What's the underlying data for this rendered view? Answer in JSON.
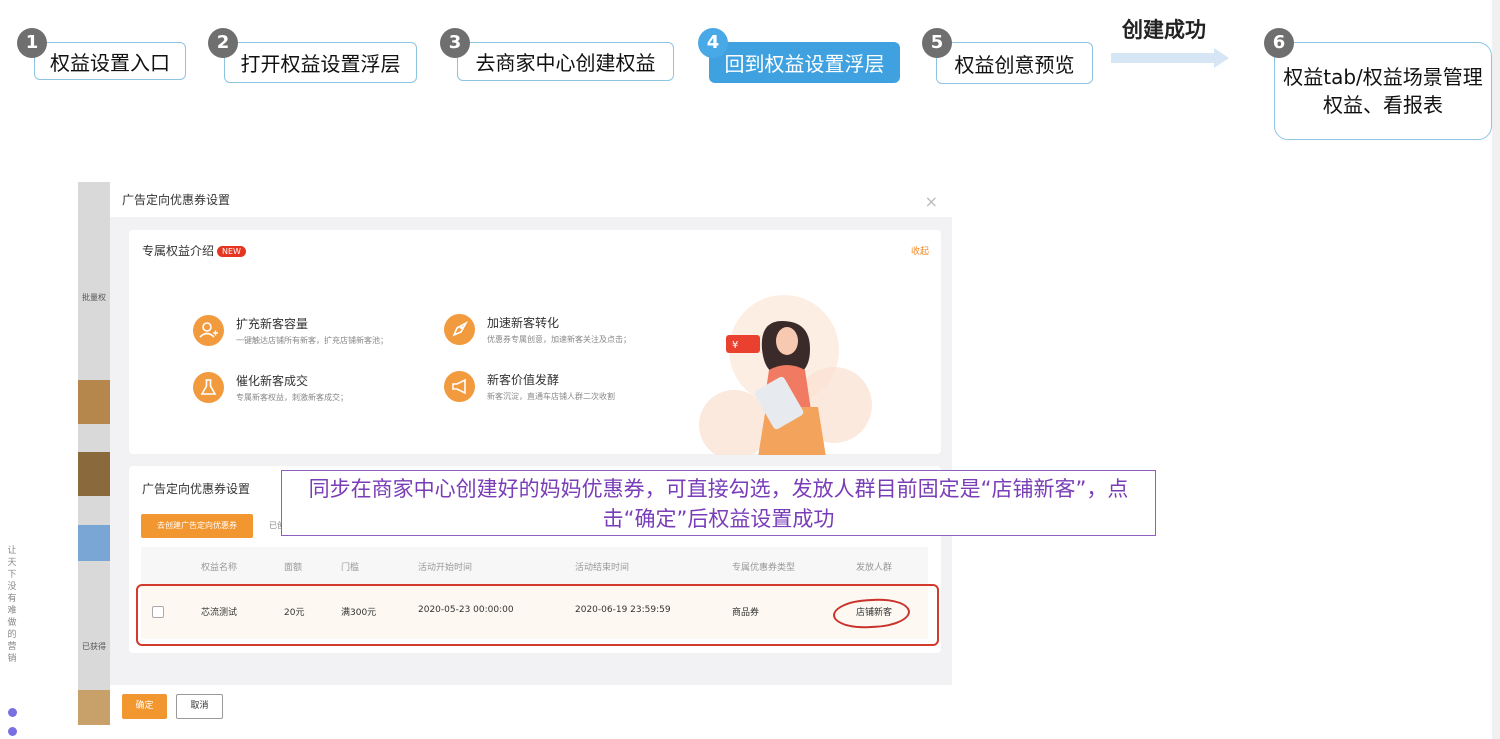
{
  "steps": [
    {
      "num": "1",
      "label": "权益设置入口"
    },
    {
      "num": "2",
      "label": "打开权益设置浮层"
    },
    {
      "num": "3",
      "label": "去商家中心创建权益"
    },
    {
      "num": "4",
      "label": "回到权益设置浮层"
    },
    {
      "num": "5",
      "label": "权益创意预览"
    },
    {
      "num": "6",
      "label": "权益tab/权益场景管理权益、看报表"
    }
  ],
  "success_label": "创建成功",
  "left_tag": [
    "让",
    "天",
    "下",
    "没",
    "有",
    "难",
    "做",
    "的",
    "营",
    "销"
  ],
  "background_fragments": {
    "batch": "批量权",
    "obtained": "已获得"
  },
  "modal": {
    "title": "广告定向优惠券设置",
    "close_symbol": "×",
    "intro": {
      "title": "专属权益介绍",
      "badge": "NEW",
      "collapse": "收起",
      "features": [
        {
          "icon": "person-plus-icon",
          "title": "扩充新客容量",
          "desc": "一键触达店铺所有新客，扩充店铺新客池；"
        },
        {
          "icon": "rocket-icon",
          "title": "加速新客转化",
          "desc": "优惠券专属创意，加速新客关注及点击；"
        },
        {
          "icon": "flask-icon",
          "title": "催化新客成交",
          "desc": "专属新客权益，刺激新客成交；"
        },
        {
          "icon": "megaphone-icon",
          "title": "新客价值发酵",
          "desc": "新客沉淀，直通车店铺人群二次收割"
        }
      ]
    },
    "coupon": {
      "title": "广告定向优惠券设置",
      "create_button": "去创建广告定向优惠券",
      "already_text": "已创",
      "columns": [
        "权益名称",
        "面额",
        "门槛",
        "活动开始时间",
        "活动结束时间",
        "专属优惠券类型",
        "发放人群"
      ],
      "rows": [
        {
          "name": "芯流测试",
          "amount": "20元",
          "threshold": "满300元",
          "start": "2020-05-23 00:00:00",
          "end": "2020-06-19 23:59:59",
          "type": "商品券",
          "audience": "店铺新客"
        }
      ]
    },
    "ok_button": "确定",
    "cancel_button": "取消"
  },
  "callout_text": "同步在商家中心创建好的妈妈优惠券，可直接勾选，发放人群目前固定是“店铺新客”，点击“确定”后权益设置成功",
  "colors": {
    "accent_orange": "#f2962f",
    "step_active": "#3fa1e0",
    "callout_purple": "#7a3db8",
    "highlight_red": "#d33a2c"
  }
}
